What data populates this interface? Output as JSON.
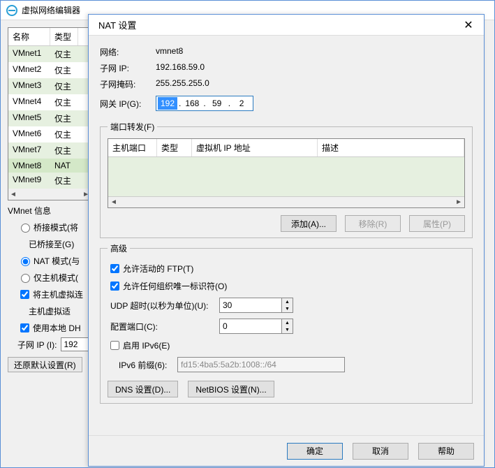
{
  "parent": {
    "title": "虚拟网络编辑器",
    "table": {
      "col_name": "名称",
      "col_type": "类型",
      "rows": [
        {
          "name": "VMnet1",
          "type": "仅主"
        },
        {
          "name": "VMnet2",
          "type": "仅主"
        },
        {
          "name": "VMnet3",
          "type": "仅主"
        },
        {
          "name": "VMnet4",
          "type": "仅主"
        },
        {
          "name": "VMnet5",
          "type": "仅主"
        },
        {
          "name": "VMnet6",
          "type": "仅主"
        },
        {
          "name": "VMnet7",
          "type": "仅主"
        },
        {
          "name": "VMnet8",
          "type": "NAT"
        },
        {
          "name": "VMnet9",
          "type": "仅主"
        }
      ]
    },
    "info_group": "VMnet 信息",
    "radio_bridge": "桥接模式(将",
    "bridged_to": "已桥接至(G)",
    "radio_nat": "NAT 模式(与",
    "radio_host": "仅主机模式(",
    "chk_connect": "将主机虚拟连",
    "host_adapter": "主机虚拟适",
    "chk_dhcp": "使用本地 DH",
    "subnet_ip_lbl": "子网 IP (I):",
    "subnet_ip_val": "192",
    "restore_btn": "还原默认设置(R)"
  },
  "modal": {
    "title": "NAT 设置",
    "net_lbl": "网络:",
    "net_val": "vmnet8",
    "subip_lbl": "子网 IP:",
    "subip_val": "192.168.59.0",
    "mask_lbl": "子网掩码:",
    "mask_val": "255.255.255.0",
    "gw_lbl": "网关 IP(G):",
    "gw_oct": [
      "192",
      "168",
      "59",
      "2"
    ],
    "pf": {
      "legend": "端口转发(F)",
      "col1": "主机端口",
      "col2": "类型",
      "col3": "虚拟机 IP 地址",
      "col4": "描述",
      "add": "添加(A)...",
      "remove": "移除(R)",
      "props": "属性(P)"
    },
    "adv": {
      "legend": "高级",
      "ftp": "允许活动的 FTP(T)",
      "oui": "允许任何组织唯一标识符(O)",
      "udp_lbl": "UDP 超时(以秒为单位)(U):",
      "udp_val": "30",
      "cfg_lbl": "配置端口(C):",
      "cfg_val": "0",
      "v6_chk": "启用 IPv6(E)",
      "v6_lbl": "IPv6 前缀(6):",
      "v6_val": "fd15:4ba5:5a2b:1008::/64",
      "dns_btn": "DNS 设置(D)...",
      "nb_btn": "NetBIOS 设置(N)..."
    },
    "ok": "确定",
    "cancel": "取消",
    "help": "帮助"
  }
}
